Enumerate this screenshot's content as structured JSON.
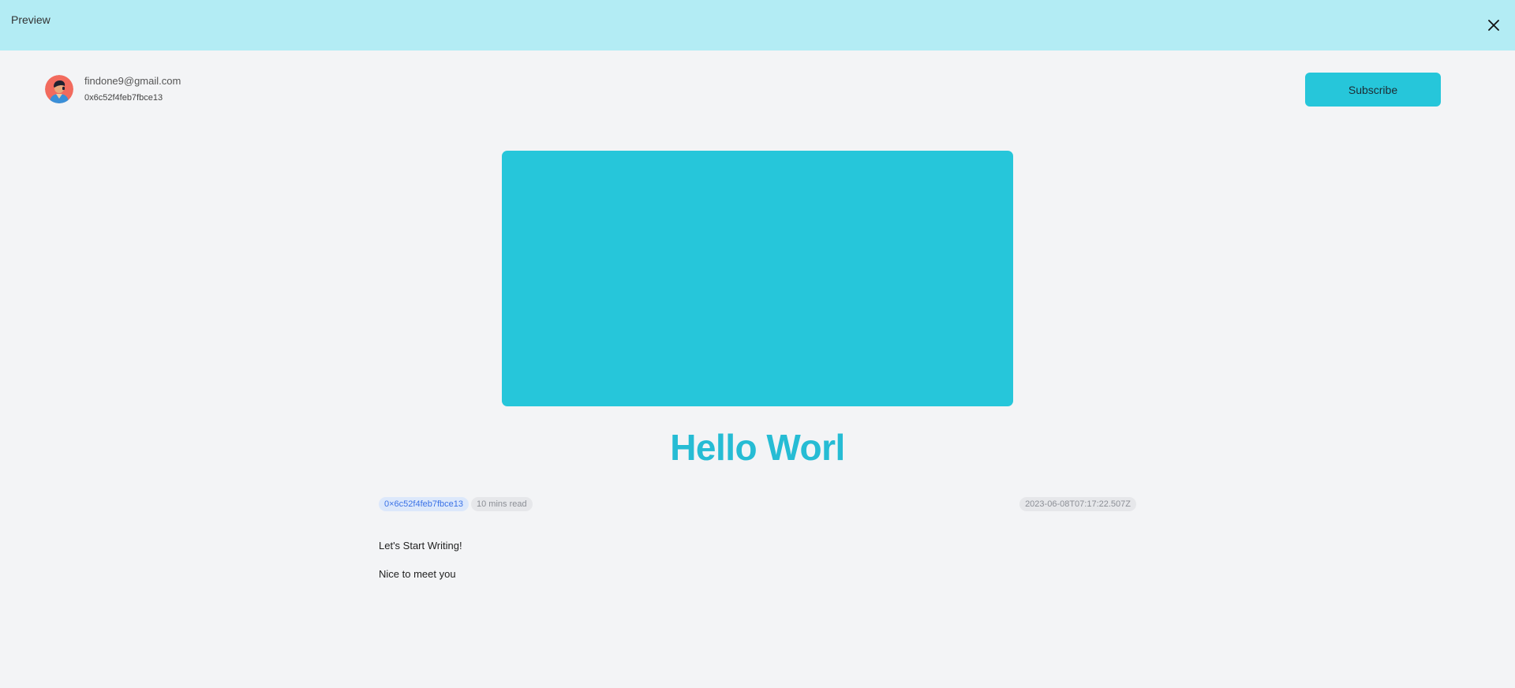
{
  "topbar": {
    "title": "Preview"
  },
  "author": {
    "email": "findone9@gmail.com",
    "address": "0x6c52f4feb7fbce13",
    "avatar_icon": "avatar-icon"
  },
  "subscribe": {
    "label": "Subscribe"
  },
  "post": {
    "title": "Hello Worl",
    "tag_address": "0×6c52f4feb7fbce13",
    "read_time": "10 mins read",
    "date": "2023-06-08T07:17:22.507Z",
    "paragraphs": [
      "Let's Start Writing!",
      "Nice to meet you"
    ]
  },
  "colors": {
    "accent": "#26c6da",
    "title": "#26bcd4",
    "topbar": "#b3ecf4",
    "tag_link": "#3b72e6"
  }
}
